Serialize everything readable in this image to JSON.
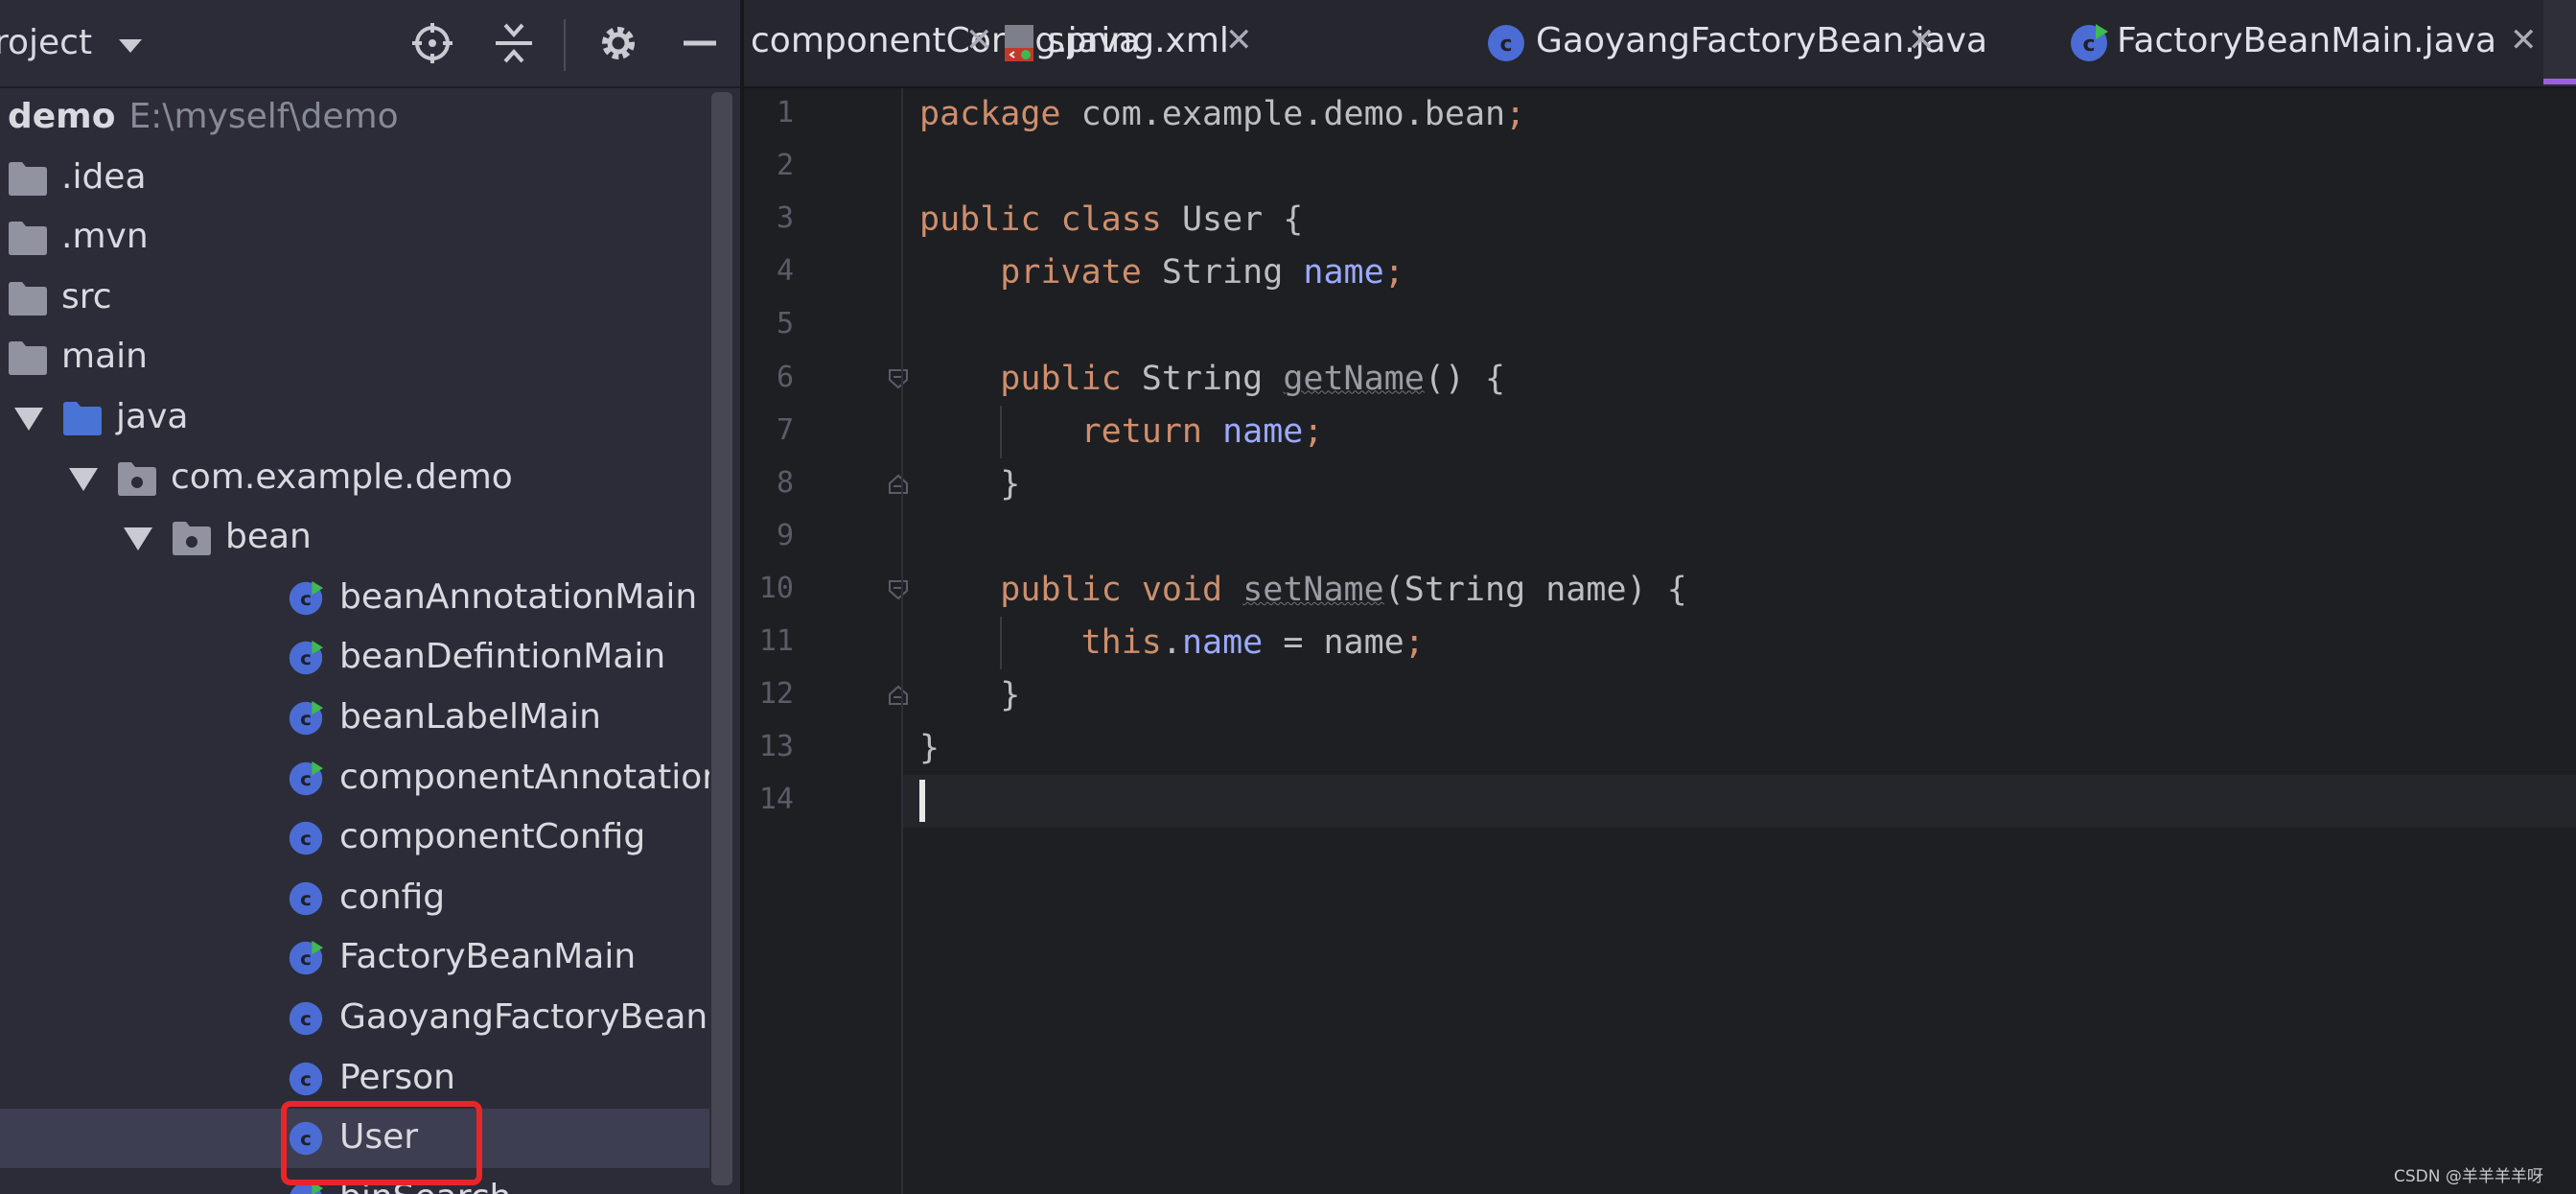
{
  "project_panel": {
    "title": "roject",
    "tree": [
      {
        "label": "demo",
        "path": "E:\\myself\\demo",
        "kind": "root"
      },
      {
        "label": ".idea",
        "kind": "folder"
      },
      {
        "label": ".mvn",
        "kind": "folder"
      },
      {
        "label": "src",
        "kind": "folder"
      },
      {
        "label": "main",
        "kind": "folder",
        "expanded": true
      },
      {
        "label": "java",
        "kind": "source-folder",
        "expanded": true
      },
      {
        "label": "com.example.demo",
        "kind": "package",
        "expanded": true
      },
      {
        "label": "bean",
        "kind": "package",
        "expanded": true
      },
      {
        "label": "beanAnnotationMain",
        "kind": "runnable-class"
      },
      {
        "label": "beanDefintionMain",
        "kind": "runnable-class"
      },
      {
        "label": "beanLabelMain",
        "kind": "runnable-class"
      },
      {
        "label": "componentAnnotationM",
        "kind": "runnable-class"
      },
      {
        "label": "componentConfig",
        "kind": "class"
      },
      {
        "label": "config",
        "kind": "class"
      },
      {
        "label": "FactoryBeanMain",
        "kind": "runnable-class"
      },
      {
        "label": "GaoyangFactoryBean",
        "kind": "class"
      },
      {
        "label": "Person",
        "kind": "class"
      },
      {
        "label": "User",
        "kind": "class",
        "selected": true
      },
      {
        "label": "binSearch",
        "kind": "runnable-class"
      }
    ]
  },
  "tabs": [
    {
      "label": "componentConfig.java",
      "icon": "class-icon"
    },
    {
      "label": "spring.xml",
      "icon": "xml-file-icon"
    },
    {
      "label": "GaoyangFactoryBean.java",
      "icon": "class-icon"
    },
    {
      "label": "FactoryBeanMain.java",
      "icon": "runnable-class-icon"
    }
  ],
  "editor": {
    "line_numbers": [
      "1",
      "2",
      "3",
      "4",
      "5",
      "6",
      "7",
      "8",
      "9",
      "10",
      "11",
      "12",
      "13",
      "14"
    ],
    "lines": [
      "package com.example.demo.bean;",
      "",
      "public class User {",
      "    private String name;",
      "",
      "    public String getName() {",
      "        return name;",
      "    }",
      "",
      "    public void setName(String name) {",
      "        this.name = name;",
      "    }",
      "}",
      ""
    ],
    "current_line": 14
  },
  "colors": {
    "keyword": "#cf8e6d",
    "field": "#9ba9ff",
    "text": "#bcbec4",
    "selection_box": "#e8262a",
    "class_icon": "#4a6cd4",
    "run_badge": "#3fb950"
  },
  "watermark": "CSDN @羊羊羊羊呀"
}
